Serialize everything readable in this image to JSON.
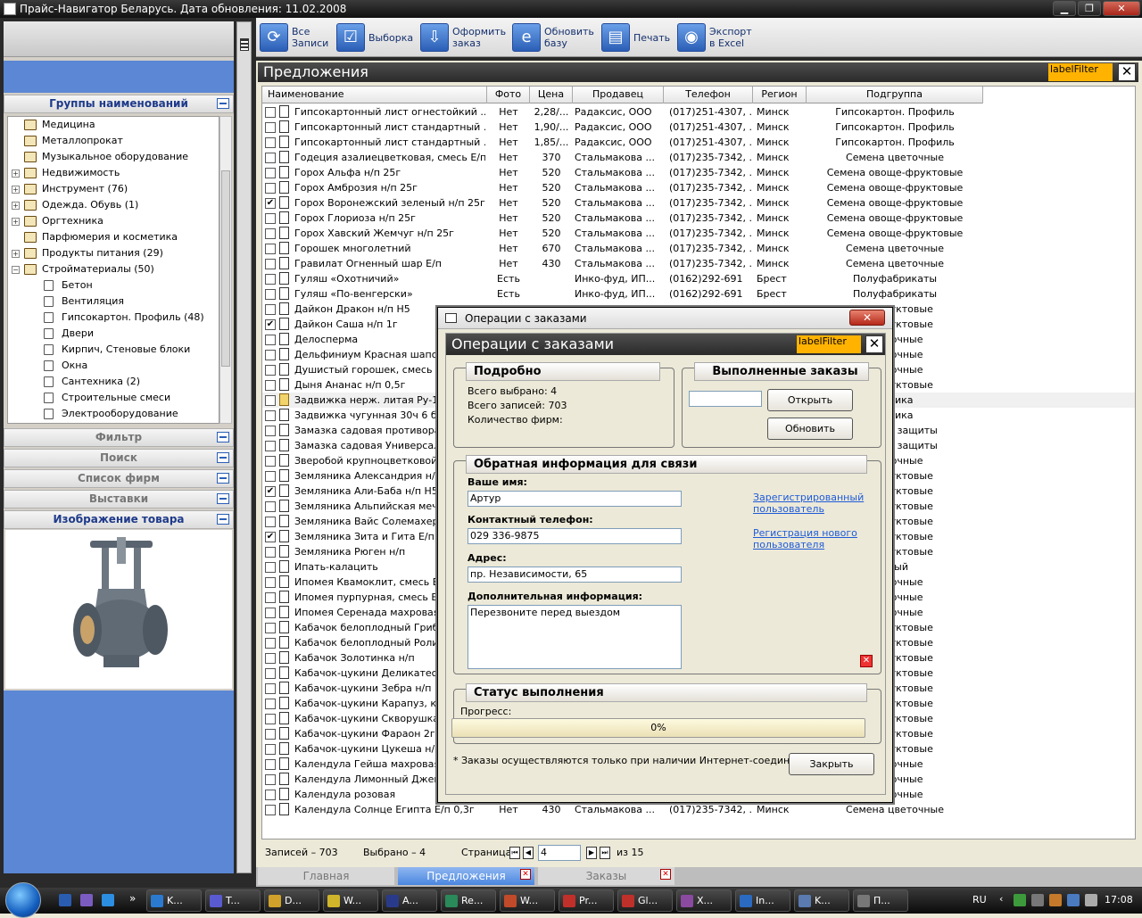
{
  "window": {
    "title": "Прайс-Навигатор Беларусь. Дата обновления: 11.02.2008",
    "min": "▁",
    "max": "❐",
    "close": "✕"
  },
  "toolbar": {
    "buttons": [
      {
        "label1": "Все",
        "label2": "Записи",
        "icon": "refresh-icon"
      },
      {
        "label1": "Выборка",
        "label2": "",
        "icon": "checklist-icon"
      },
      {
        "label1": "Оформить",
        "label2": "заказ",
        "icon": "order-icon"
      },
      {
        "label1": "Обновить",
        "label2": "базу",
        "icon": "update-db-icon"
      },
      {
        "label1": "Печать",
        "label2": "",
        "icon": "print-icon"
      },
      {
        "label1": "Экспорт",
        "label2": "в Excel",
        "icon": "export-excel-icon"
      }
    ]
  },
  "left": {
    "groups_header": "Группы наименований",
    "tree": [
      {
        "label": "Медицина",
        "level": 0,
        "exp": ""
      },
      {
        "label": "Металлопрокат",
        "level": 0,
        "exp": ""
      },
      {
        "label": "Музыкальное оборудование",
        "level": 0,
        "exp": ""
      },
      {
        "label": "Недвижимость",
        "level": 0,
        "exp": "+"
      },
      {
        "label": "Инструмент (76)",
        "level": 0,
        "exp": "+"
      },
      {
        "label": "Одежда. Обувь (1)",
        "level": 0,
        "exp": "+"
      },
      {
        "label": "Оргтехника",
        "level": 0,
        "exp": "+"
      },
      {
        "label": "Парфюмерия и косметика",
        "level": 0,
        "exp": ""
      },
      {
        "label": "Продукты питания (29)",
        "level": 0,
        "exp": "+"
      },
      {
        "label": "Стройматериалы (50)",
        "level": 0,
        "exp": "−"
      },
      {
        "label": "Бетон",
        "level": 1,
        "exp": ""
      },
      {
        "label": "Вентиляция",
        "level": 1,
        "exp": ""
      },
      {
        "label": "Гипсокартон. Профиль (48)",
        "level": 1,
        "exp": ""
      },
      {
        "label": "Двери",
        "level": 1,
        "exp": ""
      },
      {
        "label": "Кирпич, Стеновые блоки",
        "level": 1,
        "exp": ""
      },
      {
        "label": "Окна",
        "level": 1,
        "exp": ""
      },
      {
        "label": "Сантехника (2)",
        "level": 1,
        "exp": ""
      },
      {
        "label": "Строительные смеси",
        "level": 1,
        "exp": ""
      },
      {
        "label": "Электрооборудование",
        "level": 1,
        "exp": ""
      }
    ],
    "sections": [
      "Фильтр",
      "Поиск",
      "Список фирм",
      "Выставки"
    ],
    "image_header": "Изображение товара"
  },
  "panel": {
    "title": "Предложения",
    "filter_label": "labelFilter"
  },
  "grid": {
    "columns": [
      "Наименование",
      "Фото",
      "Цена",
      "Продавец",
      "Телефон",
      "Регион",
      "Подгруппа"
    ],
    "rows": [
      {
        "c": false,
        "name": "Гипсокартонный лист огнестойкий ...",
        "photo": "Нет",
        "price": "2,28/...",
        "seller": "Радаксис, ООО",
        "phone": "(017)251-4307, ...",
        "region": "Минск",
        "sub": "Гипсокартон. Профиль"
      },
      {
        "c": false,
        "name": "Гипсокартонный лист стандартный ...",
        "photo": "Нет",
        "price": "1,90/...",
        "seller": "Радаксис, ООО",
        "phone": "(017)251-4307, ...",
        "region": "Минск",
        "sub": "Гипсокартон. Профиль"
      },
      {
        "c": false,
        "name": "Гипсокартонный лист стандартный ...",
        "photo": "Нет",
        "price": "1,85/...",
        "seller": "Радаксис, ООО",
        "phone": "(017)251-4307, ...",
        "region": "Минск",
        "sub": "Гипсокартон. Профиль"
      },
      {
        "c": false,
        "name": "Годеция азалиецветковая, смесь Е/п ...",
        "photo": "Нет",
        "price": "370",
        "seller": "Стальмакова ...",
        "phone": "(017)235-7342, ...",
        "region": "Минск",
        "sub": "Семена цветочные"
      },
      {
        "c": false,
        "name": "Горох Альфа н/п 25г",
        "photo": "Нет",
        "price": "520",
        "seller": "Стальмакова ...",
        "phone": "(017)235-7342, ...",
        "region": "Минск",
        "sub": "Семена овоще-фруктовые"
      },
      {
        "c": false,
        "name": "Горох Амброзия н/п 25г",
        "photo": "Нет",
        "price": "520",
        "seller": "Стальмакова ...",
        "phone": "(017)235-7342, ...",
        "region": "Минск",
        "sub": "Семена овоще-фруктовые"
      },
      {
        "c": true,
        "name": "Горох Воронежский зеленый н/п 25г",
        "photo": "Нет",
        "price": "520",
        "seller": "Стальмакова ...",
        "phone": "(017)235-7342, ...",
        "region": "Минск",
        "sub": "Семена овоще-фруктовые"
      },
      {
        "c": false,
        "name": "Горох Глориоза н/п 25г",
        "photo": "Нет",
        "price": "520",
        "seller": "Стальмакова ...",
        "phone": "(017)235-7342, ...",
        "region": "Минск",
        "sub": "Семена овоще-фруктовые"
      },
      {
        "c": false,
        "name": "Горох Хавский Жемчуг н/п 25г",
        "photo": "Нет",
        "price": "520",
        "seller": "Стальмакова ...",
        "phone": "(017)235-7342, ...",
        "region": "Минск",
        "sub": "Семена овоще-фруктовые"
      },
      {
        "c": false,
        "name": "Горошек многолетний",
        "photo": "Нет",
        "price": "670",
        "seller": "Стальмакова ...",
        "phone": "(017)235-7342, ...",
        "region": "Минск",
        "sub": "Семена цветочные"
      },
      {
        "c": false,
        "name": "Гравилат Огненный шар Е/п",
        "photo": "Нет",
        "price": "430",
        "seller": "Стальмакова ...",
        "phone": "(017)235-7342, ...",
        "region": "Минск",
        "sub": "Семена цветочные"
      },
      {
        "c": false,
        "name": "Гуляш «Охотничий»",
        "photo": "Есть",
        "price": "",
        "seller": "Инко-фуд, ИП...",
        "phone": "(0162)292-691",
        "region": "Брест",
        "sub": "Полуфабрикаты"
      },
      {
        "c": false,
        "name": "Гуляш «По-венгерски»",
        "photo": "Есть",
        "price": "",
        "seller": "Инко-фуд, ИП...",
        "phone": "(0162)292-691",
        "region": "Брест",
        "sub": "Полуфабрикаты"
      },
      {
        "c": false,
        "name": "Дайкон Дракон н/п Н5",
        "photo": "",
        "price": "",
        "seller": "",
        "phone": "",
        "region": "",
        "sub": "ще-фруктовые"
      },
      {
        "c": true,
        "name": "Дайкон Саша н/п 1г",
        "photo": "",
        "price": "",
        "seller": "",
        "phone": "",
        "region": "",
        "sub": "ще-фруктовые"
      },
      {
        "c": false,
        "name": "Делосперма",
        "photo": "",
        "price": "",
        "seller": "",
        "phone": "",
        "region": "",
        "sub": "цветочные"
      },
      {
        "c": false,
        "name": "Дельфиниум Красная шапочк",
        "photo": "",
        "price": "",
        "seller": "",
        "phone": "",
        "region": "",
        "sub": "цветочные"
      },
      {
        "c": false,
        "name": "Душистый горошек, смесь Е/",
        "photo": "",
        "price": "",
        "seller": "",
        "phone": "",
        "region": "",
        "sub": "цветочные"
      },
      {
        "c": false,
        "name": "Дыня Ананас н/п 0,5г",
        "photo": "",
        "price": "",
        "seller": "",
        "phone": "",
        "region": "",
        "sub": "ще-фруктовые"
      },
      {
        "c": false,
        "folder": true,
        "name": "Задвижка нерж. литая Ру-16 (",
        "photo": "",
        "price": "",
        "seller": "",
        "phone": "",
        "region": "",
        "sub": "ехника"
      },
      {
        "c": false,
        "name": "Задвижка чугунная 30ч 6 бр Р",
        "photo": "",
        "price": "",
        "seller": "",
        "phone": "",
        "region": "",
        "sub": "ехника"
      },
      {
        "c": false,
        "name": "Замазка садовая противорако",
        "photo": "",
        "price": "",
        "seller": "",
        "phone": "",
        "region": "",
        "sub": "редства защиты"
      },
      {
        "c": false,
        "name": "Замазка садовая Универсальн",
        "photo": "",
        "price": "",
        "seller": "",
        "phone": "",
        "region": "",
        "sub": "редства защиты"
      },
      {
        "c": false,
        "name": "Зверобой крупноцветковой Е",
        "photo": "",
        "price": "",
        "seller": "",
        "phone": "",
        "region": "",
        "sub": "цветочные"
      },
      {
        "c": false,
        "name": "Земляника Александрия н/п",
        "photo": "",
        "price": "",
        "seller": "",
        "phone": "",
        "region": "",
        "sub": "ще-фруктовые"
      },
      {
        "c": true,
        "name": "Земляника Али-Баба н/п Н5",
        "photo": "",
        "price": "",
        "seller": "",
        "phone": "",
        "region": "",
        "sub": "ще-фруктовые"
      },
      {
        "c": false,
        "name": "Земляника Альпийская мечта",
        "photo": "",
        "price": "",
        "seller": "",
        "phone": "",
        "region": "",
        "sub": "ще-фруктовые"
      },
      {
        "c": false,
        "name": "Земляника Вайс Солемахер (",
        "photo": "",
        "price": "",
        "seller": "",
        "phone": "",
        "region": "",
        "sub": "ще-фруктовые"
      },
      {
        "c": true,
        "name": "Земляника Зита и Гита Е/п Н6",
        "photo": "",
        "price": "",
        "seller": "",
        "phone": "",
        "region": "",
        "sub": "ще-фруктовые"
      },
      {
        "c": false,
        "name": "Земляника Рюген н/п",
        "photo": "",
        "price": "",
        "seller": "",
        "phone": "",
        "region": "",
        "sub": "ще-фруктовые"
      },
      {
        "c": false,
        "name": "Ипать-калацить",
        "photo": "",
        "price": "",
        "seller": "",
        "phone": "",
        "region": "",
        "sub": "рный"
      },
      {
        "c": false,
        "name": "Ипомея Квамоклит, смесь Е/",
        "photo": "",
        "price": "",
        "seller": "",
        "phone": "",
        "region": "",
        "sub": "цветочные"
      },
      {
        "c": false,
        "name": "Ипомея пурпурная, смесь Е/",
        "photo": "",
        "price": "",
        "seller": "",
        "phone": "",
        "region": "",
        "sub": "цветочные"
      },
      {
        "c": false,
        "name": "Ипомея Серенада махровая Е",
        "photo": "",
        "price": "",
        "seller": "",
        "phone": "",
        "region": "",
        "sub": "цветочные"
      },
      {
        "c": false,
        "name": "Кабачок белоплодный Грибо",
        "photo": "",
        "price": "",
        "seller": "",
        "phone": "",
        "region": "",
        "sub": "ще-фруктовые"
      },
      {
        "c": false,
        "name": "Кабачок белоплодный Ролик",
        "photo": "",
        "price": "",
        "seller": "",
        "phone": "",
        "region": "",
        "sub": "ще-фруктовые"
      },
      {
        "c": false,
        "name": "Кабачок Золотинка н/п",
        "photo": "",
        "price": "",
        "seller": "",
        "phone": "",
        "region": "",
        "sub": "ще-фруктовые"
      },
      {
        "c": false,
        "name": "Кабачок-цукини Деликатес Е",
        "photo": "",
        "price": "",
        "seller": "",
        "phone": "",
        "region": "",
        "sub": "ще-фруктовые"
      },
      {
        "c": false,
        "name": "Кабачок-цукини Зебра н/п",
        "photo": "",
        "price": "",
        "seller": "",
        "phone": "",
        "region": "",
        "sub": "ще-фруктовые"
      },
      {
        "c": false,
        "name": "Кабачок-цукини Карапуз, кру",
        "photo": "",
        "price": "",
        "seller": "",
        "phone": "",
        "region": "",
        "sub": "ще-фруктовые"
      },
      {
        "c": false,
        "name": "Кабачок-цукини Скворушка",
        "photo": "",
        "price": "",
        "seller": "",
        "phone": "",
        "region": "",
        "sub": "ще-фруктовые"
      },
      {
        "c": false,
        "name": "Кабачок-цукини Фараон 2г",
        "photo": "",
        "price": "",
        "seller": "",
        "phone": "",
        "region": "",
        "sub": "ще-фруктовые"
      },
      {
        "c": false,
        "name": "Кабачок-цукини Цукеша н/п",
        "photo": "",
        "price": "",
        "seller": "",
        "phone": "",
        "region": "",
        "sub": "ще-фруктовые"
      },
      {
        "c": false,
        "name": "Календула Гейша махровая Е",
        "photo": "",
        "price": "",
        "seller": "",
        "phone": "",
        "region": "",
        "sub": "цветочные"
      },
      {
        "c": false,
        "name": "Календула Лимонный Джем Е",
        "photo": "",
        "price": "",
        "seller": "",
        "phone": "",
        "region": "",
        "sub": "цветочные"
      },
      {
        "c": false,
        "name": "Календула розовая",
        "photo": "",
        "price": "",
        "seller": "",
        "phone": "",
        "region": "",
        "sub": "цветочные"
      },
      {
        "c": false,
        "name": "Календула Солнце Египта Е/п 0,3г",
        "photo": "Нет",
        "price": "430",
        "seller": "Стальмакова ...",
        "phone": "(017)235-7342, ...",
        "region": "Минск",
        "sub": "Семена цветочные"
      }
    ]
  },
  "status": {
    "records": "Записей – 703",
    "selected": "Выбрано – 4",
    "page_label": "Страница",
    "page": "4",
    "of": "из 15"
  },
  "tabs": [
    {
      "label": "Главная"
    },
    {
      "label": "Предложения"
    },
    {
      "label": "Заказы"
    }
  ],
  "dialog": {
    "window_title": "Операции с заказами",
    "header": "Операции с заказами",
    "filter_label": "labelFilter",
    "details": {
      "title": "Подробно",
      "total_selected": "Всего выбрано: 4",
      "total_records": "Всего записей: 703",
      "firms": "Количество фирм:"
    },
    "done": {
      "title": "Выполненные заказы",
      "open": "Открыть",
      "refresh": "Обновить"
    },
    "contact": {
      "title": "Обратная информация для связи",
      "name_label": "Ваше имя:",
      "name_value": "Артур",
      "phone_label": "Контактный телефон:",
      "phone_value": "029 336-9875",
      "address_label": "Адрес:",
      "address_value": "пр. Независимости, 65",
      "extra_label": "Дополнительная информация:",
      "extra_value": "Перезвоните перед выездом",
      "link_registered": "Зарегистрированный пользователь",
      "link_new": "Регистрация нового пользователя"
    },
    "status": {
      "title": "Статус выполнения",
      "progress_label": "Прогресс:",
      "progress_text": "0%",
      "progress": 0
    },
    "note": "* Заказы осуществляются только при наличии Интернет-соединения",
    "close": "Закрыть"
  },
  "taskbar": {
    "items": [
      "K...",
      "T...",
      "D...",
      "W...",
      "A...",
      "Re...",
      "W...",
      "Pr...",
      "Gl...",
      "X...",
      "In...",
      "K...",
      "П..."
    ],
    "lang": "RU",
    "time": "17:08"
  }
}
